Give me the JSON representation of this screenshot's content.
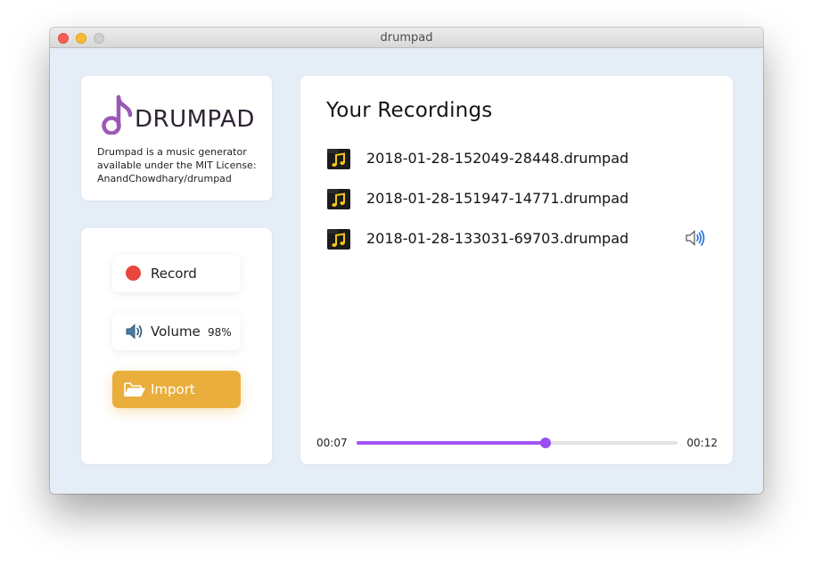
{
  "window": {
    "title": "drumpad"
  },
  "about": {
    "logo_text": "DRUMPAD",
    "description_lines": [
      "Drumpad is a music generator",
      "available under the MIT License:",
      "AnandChowdhary/drumpad"
    ]
  },
  "controls": {
    "record_label": "Record",
    "volume_label": "Volume",
    "volume_value": "98%",
    "import_label": "Import"
  },
  "recordings": {
    "title": "Your Recordings",
    "items": [
      {
        "name": "2018-01-28-152049-28448.drumpad",
        "icon": "music-file-icon",
        "playing": false
      },
      {
        "name": "2018-01-28-151947-14771.drumpad",
        "icon": "music-file-icon",
        "playing": false
      },
      {
        "name": "2018-01-28-133031-69703.drumpad",
        "icon": "music-file-icon",
        "playing": true
      }
    ]
  },
  "player": {
    "current_time": "00:07",
    "total_time": "00:12",
    "progress_fraction": 0.59
  },
  "colors": {
    "accent": "#a155f5",
    "record": "#e9473c",
    "import": "#e9ae3b",
    "logo": "#9b59b6"
  }
}
